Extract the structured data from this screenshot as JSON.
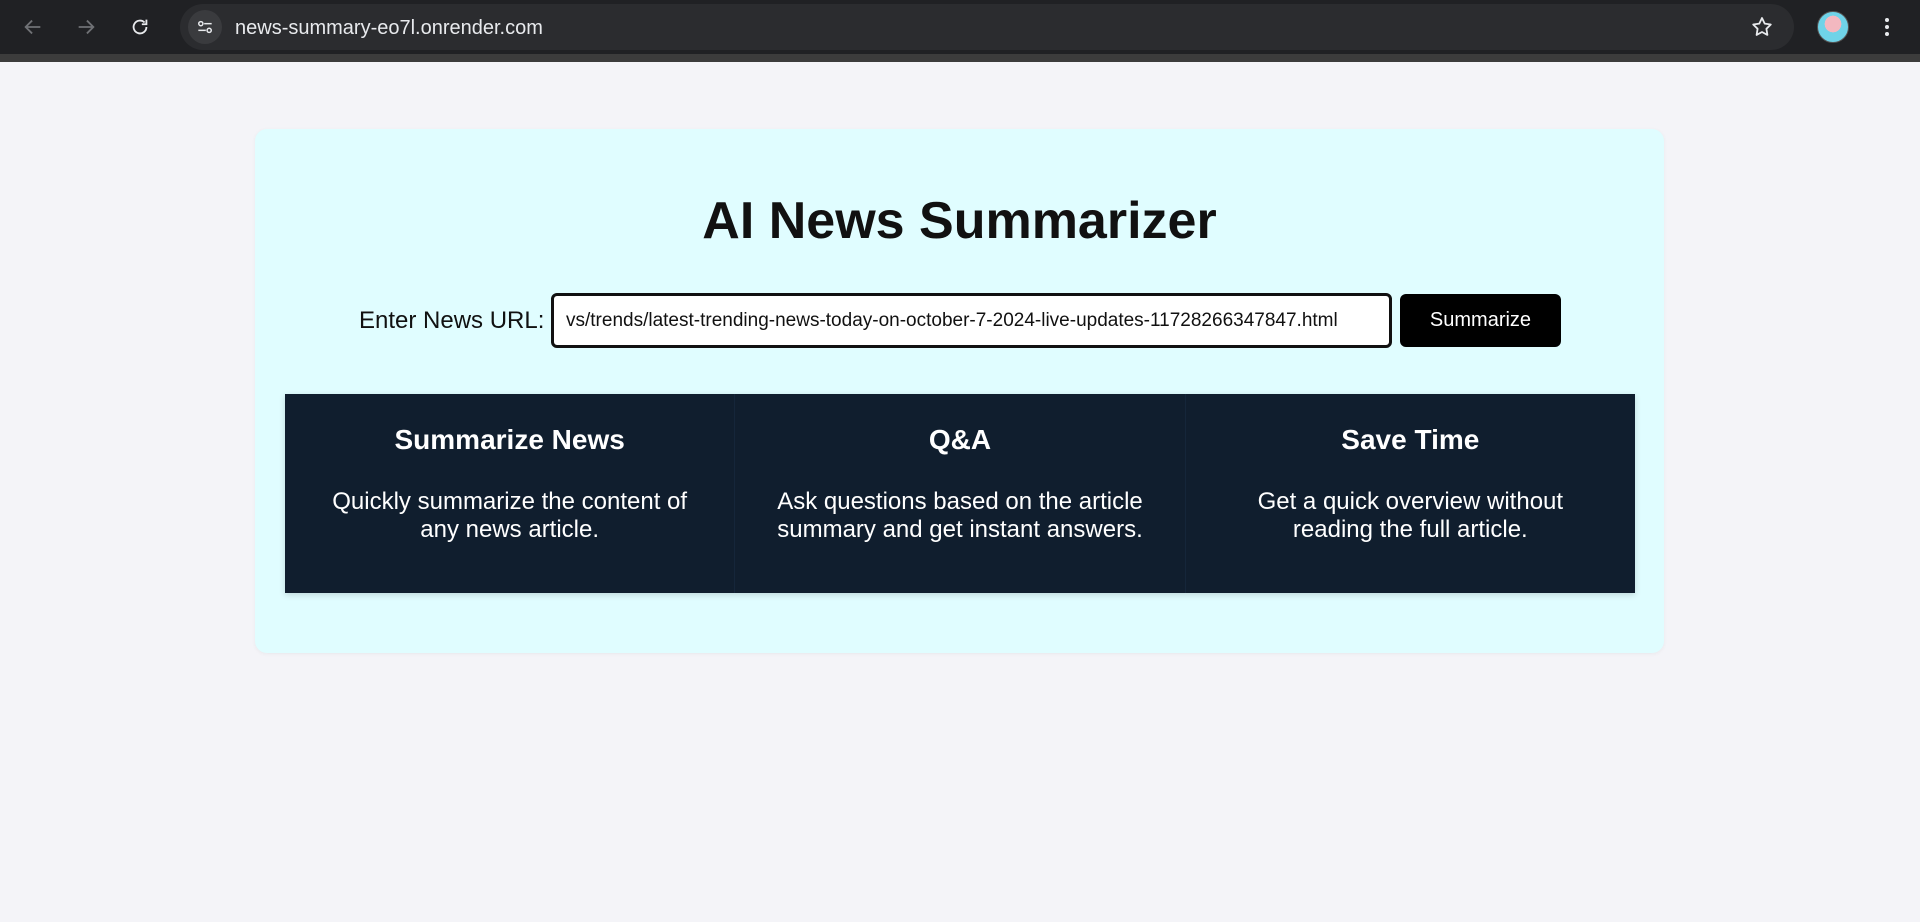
{
  "browser": {
    "url": "news-summary-eo7l.onrender.com",
    "icons": [
      "back-arrow-icon",
      "forward-arrow-icon",
      "reload-icon",
      "site-settings-icon",
      "bookmark-star-icon",
      "profile-avatar",
      "more-menu-icon"
    ]
  },
  "page": {
    "title": "AI News Summarizer",
    "url_label": "Enter News URL:",
    "url_value": "vs/trends/latest-trending-news-today-on-october-7-2024-live-updates-11728266347847.html",
    "summarize_label": "Summarize",
    "features": [
      {
        "title": "Summarize News",
        "description": "Quickly summarize the content of any news article."
      },
      {
        "title": "Q&A",
        "description": "Ask questions based on the article summary and get instant answers."
      },
      {
        "title": "Save Time",
        "description": "Get a quick overview without reading the full article."
      }
    ]
  },
  "colors": {
    "card_background": "#e0fdff",
    "features_background": "#101e2e",
    "button_background": "#000000"
  }
}
